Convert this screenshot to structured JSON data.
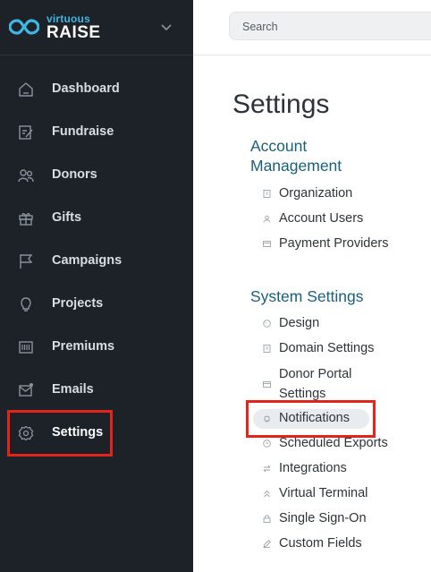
{
  "brand": {
    "small": "virtuous",
    "big": "RAISE"
  },
  "search": {
    "placeholder": "Search"
  },
  "sidebar": {
    "items": [
      {
        "label": "Dashboard",
        "icon": "home-icon"
      },
      {
        "label": "Fundraise",
        "icon": "edit-icon"
      },
      {
        "label": "Donors",
        "icon": "users-icon"
      },
      {
        "label": "Gifts",
        "icon": "gift-icon"
      },
      {
        "label": "Campaigns",
        "icon": "flag-icon"
      },
      {
        "label": "Projects",
        "icon": "lightbulb-icon"
      },
      {
        "label": "Premiums",
        "icon": "barcode-icon"
      },
      {
        "label": "Emails",
        "icon": "mail-icon"
      },
      {
        "label": "Settings",
        "icon": "gear-icon",
        "active": true
      }
    ]
  },
  "page": {
    "title": "Settings"
  },
  "sections": [
    {
      "title_line1": "Account",
      "title_line2": "Management",
      "links": [
        {
          "label": "Organization",
          "icon": "building-icon"
        },
        {
          "label": "Account Users",
          "icon": "user-icon"
        },
        {
          "label": "Payment Providers",
          "icon": "card-icon"
        }
      ]
    },
    {
      "title": "System Settings",
      "links": [
        {
          "label": "Design",
          "icon": "palette-icon"
        },
        {
          "label": "Domain Settings",
          "icon": "building-icon"
        },
        {
          "label_line1": "Donor Portal",
          "label_line2": "Settings",
          "icon": "card-icon"
        },
        {
          "label": "Notifications",
          "icon": "bell-icon"
        },
        {
          "label": "Scheduled Exports",
          "icon": "clock-icon"
        },
        {
          "label": "Integrations",
          "icon": "arrows-icon"
        },
        {
          "label": "Virtual Terminal",
          "icon": "chevrons-up-icon"
        },
        {
          "label": "Single Sign-On",
          "icon": "lock-icon"
        },
        {
          "label": "Custom Fields",
          "icon": "pencil-icon"
        }
      ]
    }
  ],
  "colors": {
    "sidebar_bg": "#1c2228",
    "accent": "#1a5f7a",
    "highlight": "#e1251b",
    "brand_blue": "#3fb6e4"
  }
}
